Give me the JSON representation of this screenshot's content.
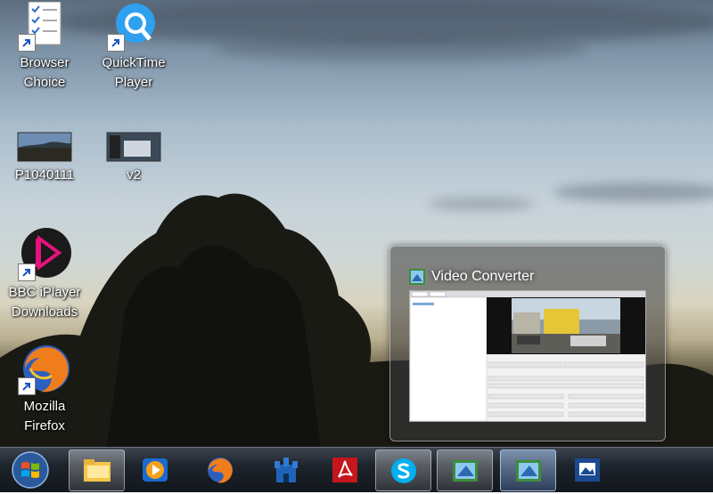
{
  "desktop": {
    "icons": [
      {
        "label_lines": [
          "Browser",
          "Choice"
        ],
        "icon": "browser-choice-icon"
      },
      {
        "label_lines": [
          "QuickTime",
          "Player"
        ],
        "icon": "quicktime-icon"
      },
      {
        "label_lines": [
          "P1040111"
        ],
        "icon": "photo-thumbnail-icon"
      },
      {
        "label_lines": [
          "v2"
        ],
        "icon": "video-thumbnail-icon"
      },
      {
        "label_lines": [
          "BBC iPlayer",
          "Downloads"
        ],
        "icon": "bbc-iplayer-icon"
      },
      {
        "label_lines": [
          "Mozilla",
          "Firefox"
        ],
        "icon": "firefox-icon"
      }
    ]
  },
  "thumbnail": {
    "title": "Video Converter",
    "icon": "video-converter-icon"
  },
  "taskbar": {
    "start": {
      "icon": "windows-start-icon"
    },
    "buttons": [
      {
        "icon": "file-explorer-icon",
        "state": "active"
      },
      {
        "icon": "media-player-icon",
        "state": "normal"
      },
      {
        "icon": "firefox-icon",
        "state": "normal"
      },
      {
        "icon": "castle-app-icon",
        "state": "normal"
      },
      {
        "icon": "adobe-reader-icon",
        "state": "normal"
      },
      {
        "icon": "skype-icon",
        "state": "active"
      },
      {
        "icon": "video-converter-icon",
        "state": "active"
      },
      {
        "icon": "video-converter-icon",
        "state": "selected"
      },
      {
        "icon": "photo-viewer-icon",
        "state": "normal"
      }
    ]
  },
  "colors": {
    "taskbar": "#1e242c",
    "accent": "#2a7ed8"
  }
}
